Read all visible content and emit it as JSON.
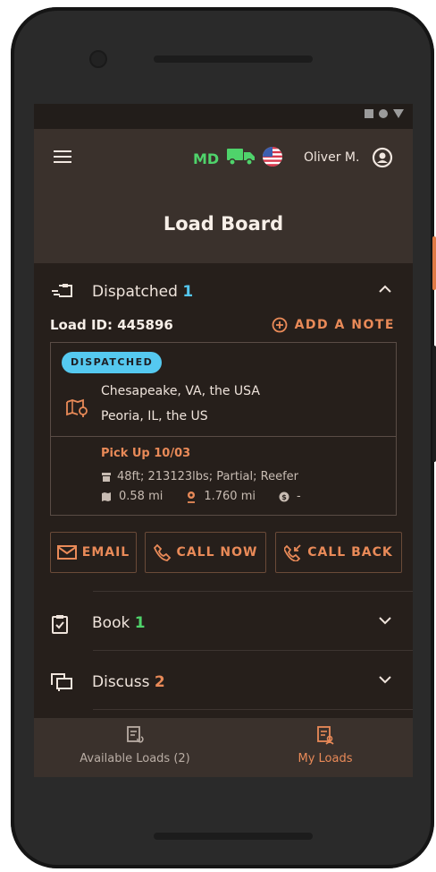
{
  "header": {
    "badge": "MD",
    "user_name": "Oliver M.",
    "title": "Load Board"
  },
  "sections": {
    "dispatched": {
      "label": "Dispatched",
      "count": "1"
    },
    "book": {
      "label": "Book",
      "count": "1"
    },
    "discuss": {
      "label": "Discuss",
      "count": "2"
    }
  },
  "load": {
    "id_label": "Load ID: 445896",
    "add_note_label": "ADD A NOTE",
    "status": "DISPATCHED",
    "origin": "Chesapeake, VA, the USA",
    "destination": "Peoria, IL, the US",
    "pickup": "Pick Up 10/03",
    "details": "48ft; 213123lbs; Partial; Reefer",
    "deadhead": "0.58 mi",
    "distance": "1.760 mi",
    "rate": "-"
  },
  "actions": {
    "email": "EMAIL",
    "call_now": "CALL NOW",
    "call_back": "CALL BACK"
  },
  "bottom_nav": {
    "available": "Available Loads (2)",
    "my_loads": "My Loads"
  },
  "colors": {
    "accent": "#e98a58",
    "green": "#4fd36b",
    "blue": "#54c6ee",
    "background": "#261f1b"
  }
}
